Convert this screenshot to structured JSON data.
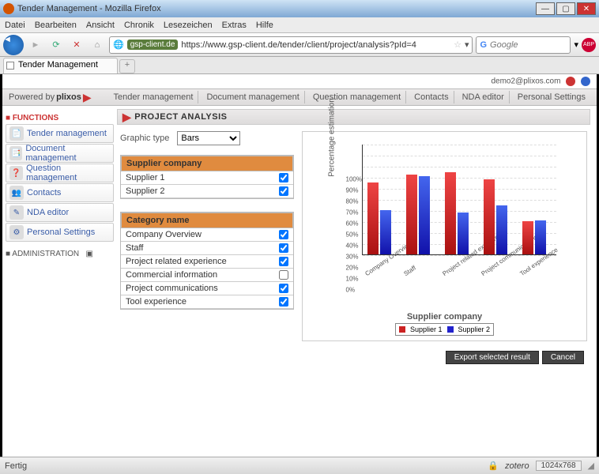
{
  "window": {
    "title": "Tender Management - Mozilla Firefox"
  },
  "menu": [
    "Datei",
    "Bearbeiten",
    "Ansicht",
    "Chronik",
    "Lesezeichen",
    "Extras",
    "Hilfe"
  ],
  "url": {
    "host": "gsp-client.de",
    "full": "https://www.gsp-client.de/tender/client/project/analysis?pId=4"
  },
  "search": {
    "engine": "Google",
    "placeholder": "Google"
  },
  "tab": {
    "title": "Tender Management"
  },
  "user": {
    "email": "demo2@plixos.com"
  },
  "powered_by": "Powered by",
  "brand": "plixos",
  "topnav": [
    "Tender management",
    "Document management",
    "Question management",
    "Contacts",
    "NDA editor",
    "Personal Settings"
  ],
  "sidebar": {
    "section1": "FUNCTIONS",
    "items": [
      {
        "label": "Tender management"
      },
      {
        "label": "Document management"
      },
      {
        "label": "Question management"
      },
      {
        "label": "Contacts"
      },
      {
        "label": "NDA editor"
      },
      {
        "label": "Personal Settings"
      }
    ],
    "section2": "ADMINISTRATION"
  },
  "page": {
    "title": "PROJECT ANALYSIS"
  },
  "form": {
    "graphic_type_label": "Graphic type",
    "graphic_type_value": "Bars",
    "supplier_header": "Supplier company",
    "suppliers": [
      {
        "name": "Supplier 1",
        "checked": true
      },
      {
        "name": "Supplier 2",
        "checked": true
      }
    ],
    "category_header": "Category name",
    "categories": [
      {
        "name": "Company Overview",
        "checked": true
      },
      {
        "name": "Staff",
        "checked": true
      },
      {
        "name": "Project related experience",
        "checked": true
      },
      {
        "name": "Commercial information",
        "checked": false
      },
      {
        "name": "Project communications",
        "checked": true
      },
      {
        "name": "Tool experience",
        "checked": true
      }
    ]
  },
  "chart_data": {
    "type": "bar",
    "xlabel": "Supplier company",
    "ylabel": "Percentage estimation",
    "ylim": [
      0,
      100
    ],
    "yticks": [
      0,
      10,
      20,
      30,
      40,
      50,
      60,
      70,
      80,
      90,
      100
    ],
    "categories": [
      "Company Overview",
      "Staff",
      "Project related experience",
      "Project communications",
      "Tool experience"
    ],
    "series": [
      {
        "name": "Supplier 1",
        "values": [
          65,
          72,
          74,
          68,
          30
        ]
      },
      {
        "name": "Supplier 2",
        "values": [
          40,
          71,
          38,
          44,
          31
        ]
      }
    ]
  },
  "buttons": {
    "export": "Export selected result",
    "cancel": "Cancel"
  },
  "status": {
    "left": "Fertig",
    "zotero": "zotero",
    "dim": "1024x768"
  }
}
